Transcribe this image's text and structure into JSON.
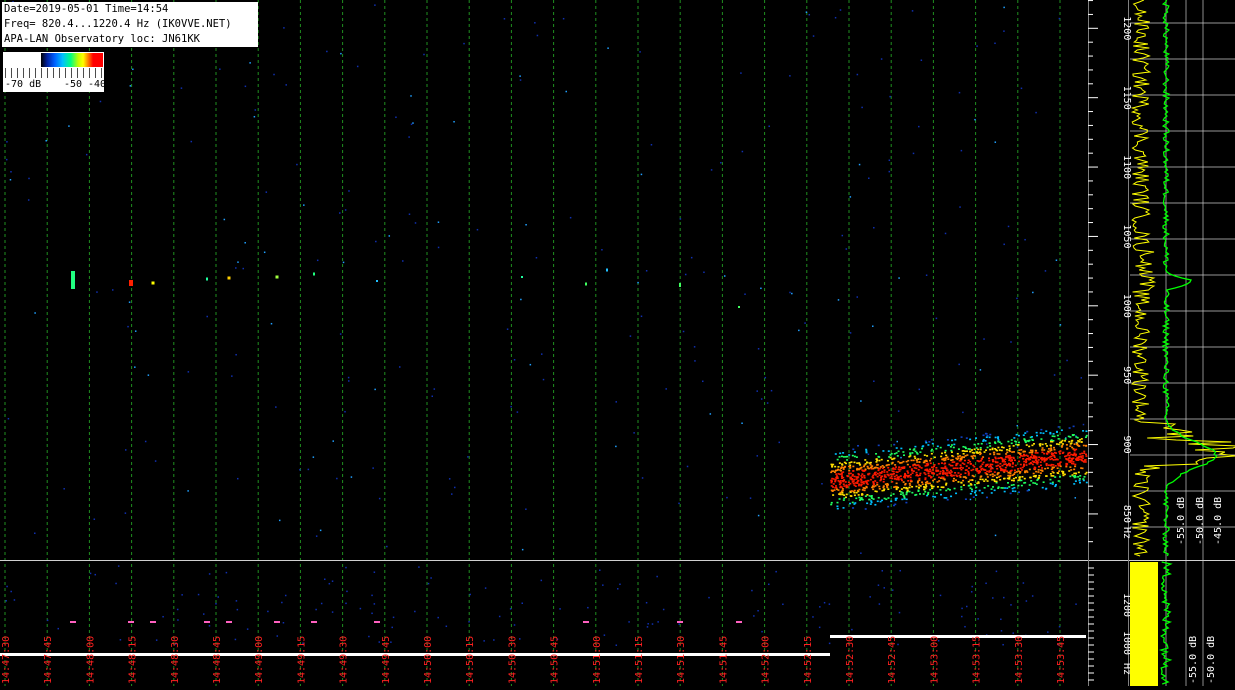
{
  "info": {
    "line1": "Date=2019-05-01 Time=14:54",
    "line2": "Freq= 820.4...1220.4 Hz (IK0VVE.NET)",
    "line3": "APA-LAN Observatory loc: JN61KK"
  },
  "colorbar": {
    "label_low": "-70 dB",
    "label_mid": "-50",
    "label_high": "-40"
  },
  "freq_axis": {
    "labels": [
      "1200",
      "1150",
      "1100",
      "1050",
      "1000",
      "950",
      "900",
      "850",
      "Hz"
    ]
  },
  "db_axis": {
    "labels": [
      "-55.0 dB",
      "-50.0 dB",
      "-45.0 dB"
    ]
  },
  "bottom_freq_axis": {
    "labels": [
      "1200",
      "1000",
      "Hz"
    ]
  },
  "bottom_db_axis": {
    "labels": [
      "-55.0 dB",
      "-50.0 dB"
    ]
  },
  "time_axis": {
    "labels": [
      "14:47:30",
      "14:47:45",
      "14:48:00",
      "14:48:15",
      "14:48:30",
      "14:48:45",
      "14:49:00",
      "14:49:15",
      "14:49:30",
      "14:49:45",
      "14:50:00",
      "14:50:15",
      "14:50:30",
      "14:50:45",
      "14:51:00",
      "14:51:15",
      "14:51:30",
      "14:51:45",
      "14:52:00",
      "14:52:15",
      "14:52:30",
      "14:52:45",
      "14:53:00",
      "14:53:15",
      "14:53:30",
      "14:53:45"
    ]
  },
  "colors": {
    "grid": "#1f8f1f",
    "spectrum_peak": "#ffff00",
    "spectrum_avg": "#00ff00",
    "time_label": "#ff2020",
    "axis_label": "#ffffff"
  }
}
